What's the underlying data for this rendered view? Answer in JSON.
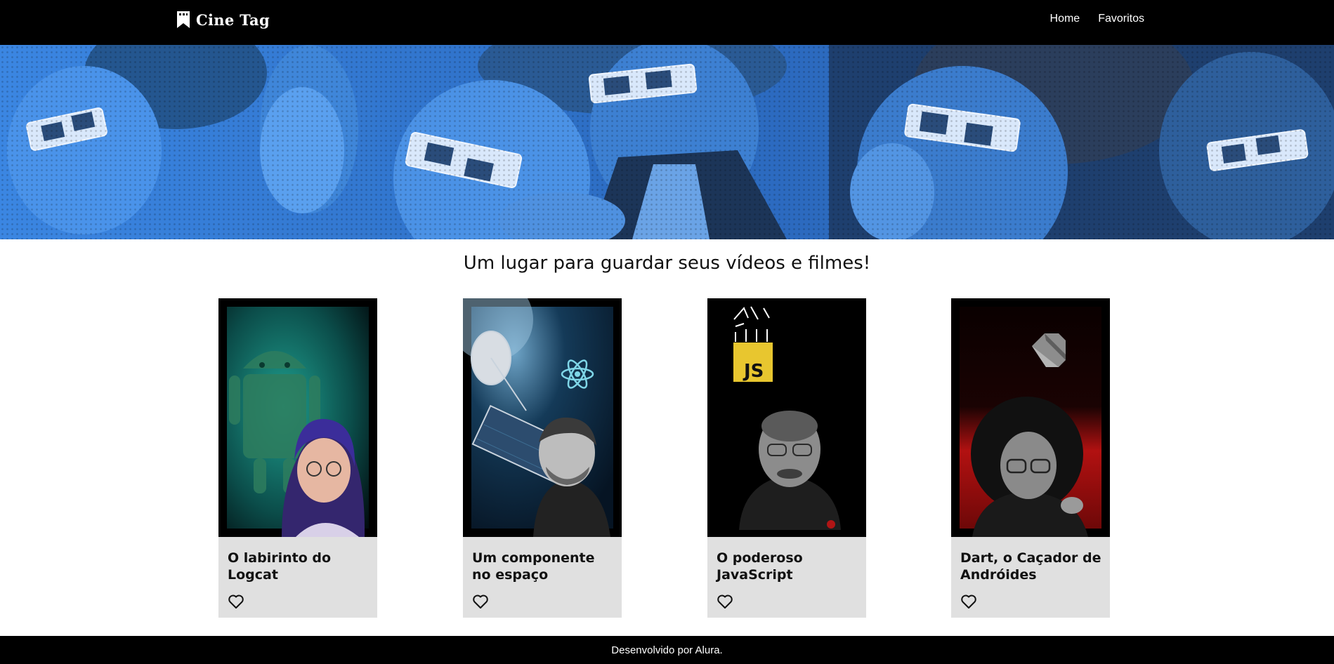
{
  "header": {
    "logo_text": "Cine Tag",
    "nav": [
      {
        "label": "Home"
      },
      {
        "label": "Favoritos"
      }
    ]
  },
  "banner": {
    "icon": "cinema-audience-3d-glasses-image",
    "tint_color": "#3a82e0"
  },
  "main": {
    "title": "Um lugar para guardar seus vídeos e filmes!"
  },
  "cards": [
    {
      "title": "O labirinto do Logcat",
      "cover": "android-robot-teal-thumbnail",
      "favorite_icon": "heart-outline-icon"
    },
    {
      "title": "Um componente no espaço",
      "cover": "react-satellite-space-thumbnail",
      "favorite_icon": "heart-outline-icon"
    },
    {
      "title": "O poderoso JavaScript",
      "cover": "javascript-logo-thumbnail",
      "favorite_icon": "heart-outline-icon"
    },
    {
      "title": "Dart, o Caçador de Andróides",
      "cover": "dart-logo-red-thumbnail",
      "favorite_icon": "heart-outline-icon"
    }
  ],
  "footer": {
    "text": "Desenvolvido por Alura."
  }
}
